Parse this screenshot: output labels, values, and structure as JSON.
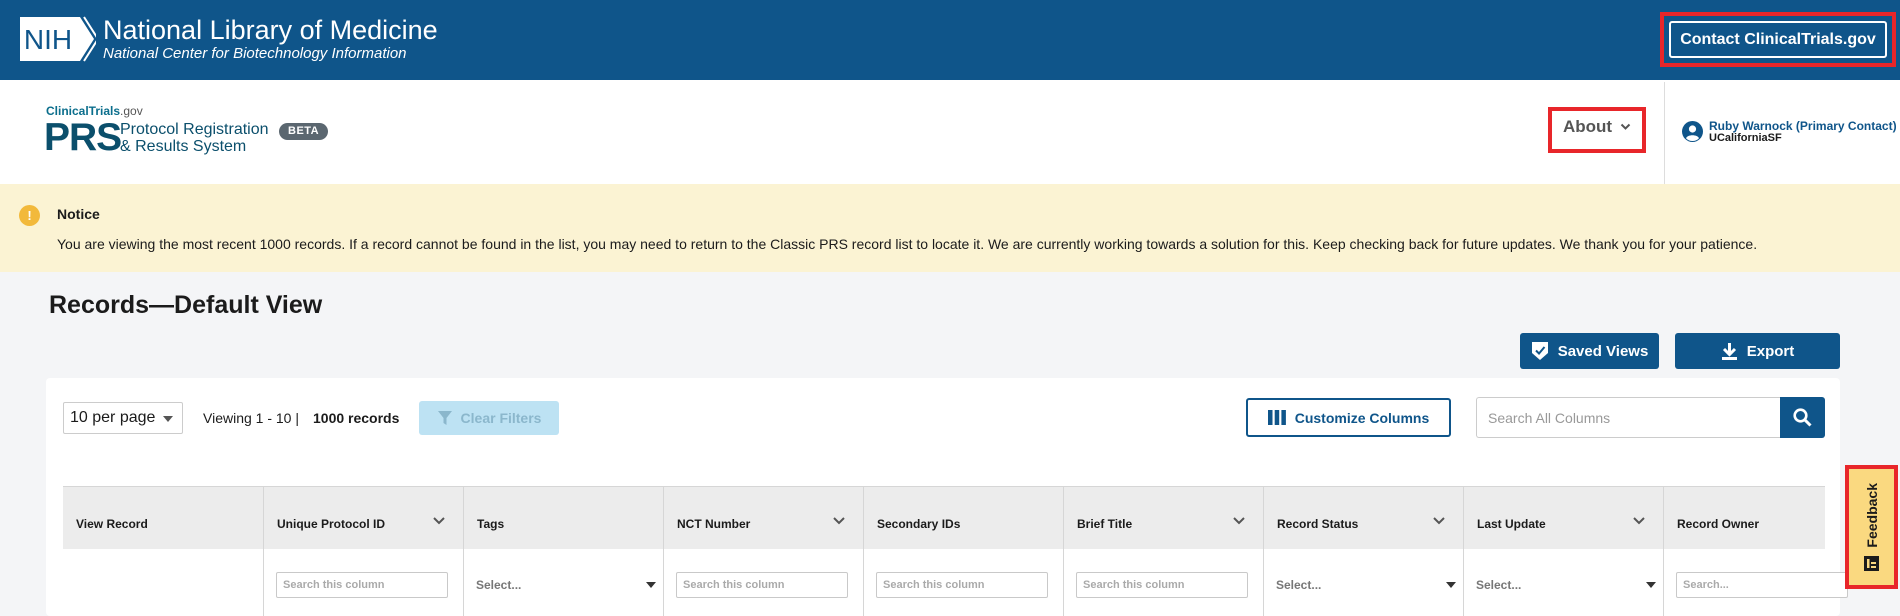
{
  "nih": {
    "logo_text": "NIH",
    "title": "National Library of Medicine",
    "subtitle": "National Center for Biotechnology Information",
    "contact_label": "Contact ClinicalTrials.gov"
  },
  "prs": {
    "ct_brand": "ClinicalTrials",
    "ct_suffix": ".gov",
    "acronym": "PRS",
    "name_line1": "Protocol Registration",
    "name_line2": "& Results System",
    "beta": "BETA",
    "about_label": "About",
    "user_name": "Ruby Warnock (Primary Contact)",
    "user_org": "UCaliforniaSF"
  },
  "notice": {
    "icon": "!",
    "title": "Notice",
    "body": "You are viewing the most recent 1000 records. If a record cannot be found in the list, you may need to return to the Classic PRS record list to locate it. We are currently working towards a solution for this. Keep checking back for future updates. We thank you for your patience."
  },
  "page": {
    "title": "Records—Default View",
    "saved_views": "Saved Views",
    "export": "Export"
  },
  "toolbar": {
    "per_page": "10 per page",
    "viewing": "Viewing 1 - 10 |",
    "records": "1000 records",
    "clear_filters": "Clear Filters",
    "customize_columns": "Customize Columns",
    "search_placeholder": "Search All Columns"
  },
  "table": {
    "columns": [
      {
        "label": "View Record",
        "sort": false,
        "filter": "none",
        "filter_text": ""
      },
      {
        "label": "Unique Protocol ID",
        "sort": true,
        "filter": "input",
        "filter_text": "Search this column"
      },
      {
        "label": "Tags",
        "sort": false,
        "filter": "select",
        "filter_text": "Select..."
      },
      {
        "label": "NCT Number",
        "sort": true,
        "filter": "input",
        "filter_text": "Search this column"
      },
      {
        "label": "Secondary IDs",
        "sort": false,
        "filter": "input",
        "filter_text": "Search this column"
      },
      {
        "label": "Brief Title",
        "sort": true,
        "filter": "input",
        "filter_text": "Search this column"
      },
      {
        "label": "Record Status",
        "sort": true,
        "filter": "select",
        "filter_text": "Select..."
      },
      {
        "label": "Last Update",
        "sort": true,
        "filter": "select",
        "filter_text": "Select..."
      },
      {
        "label": "Record Owner",
        "sort": false,
        "filter": "input",
        "filter_text": "Search..."
      }
    ]
  },
  "feedback": {
    "label": "Feedback"
  },
  "colors": {
    "nih_blue": "#0f558a",
    "highlight_red": "#e8262a",
    "notice_bg": "#fbf3d3",
    "feedback_bg": "#fad980"
  }
}
